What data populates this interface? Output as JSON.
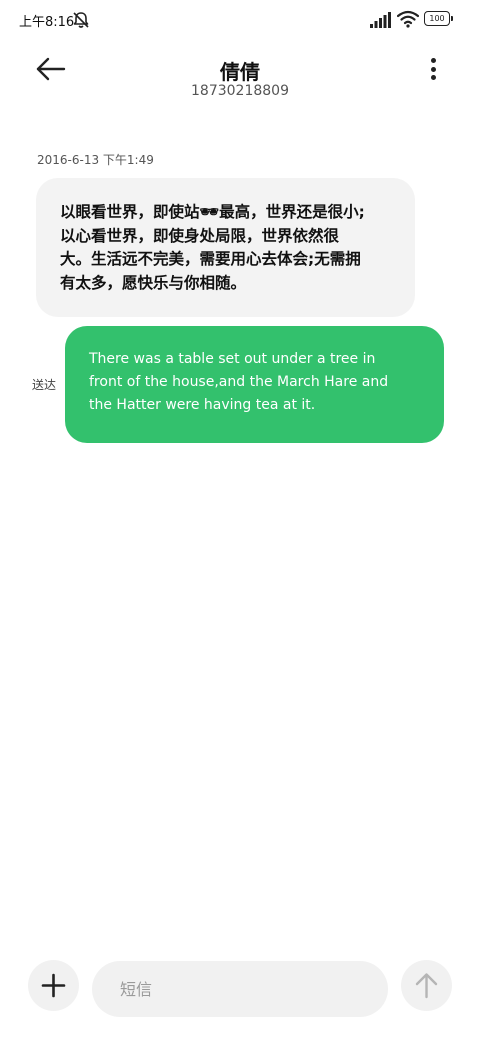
{
  "status_bar": {
    "time": "上午8:16",
    "battery": "100",
    "icons": [
      "dnd-bell-off-icon",
      "signal-icon",
      "wifi-icon",
      "battery-icon"
    ]
  },
  "header": {
    "back_icon": "arrow-left-icon",
    "contact_name": "倩倩",
    "contact_number": "18730218809",
    "more_icon": "more-vertical-icon"
  },
  "conversation": {
    "timestamp": "2016-6-13 下午1:49",
    "incoming_message": "以眼看世界，即使站🕶最高，世界还是很小;\n以心看世界，即使身处局限，世界依然很\n大。生活远不完美，需要用心去体会;无需拥\n有太多，愿快乐与你相随。",
    "outgoing_message": "There was a table set out under a tree in\nfront of the house,and the March Hare and\nthe Hatter were having tea at it.",
    "outgoing_status": "送达"
  },
  "composer": {
    "add_icon": "plus-icon",
    "placeholder": "短信",
    "send_icon": "arrow-up-icon"
  },
  "colors": {
    "outgoing_bubble": "#33c16d",
    "incoming_bubble": "#f3f3f3",
    "composer_background": "#f1f1f1"
  }
}
